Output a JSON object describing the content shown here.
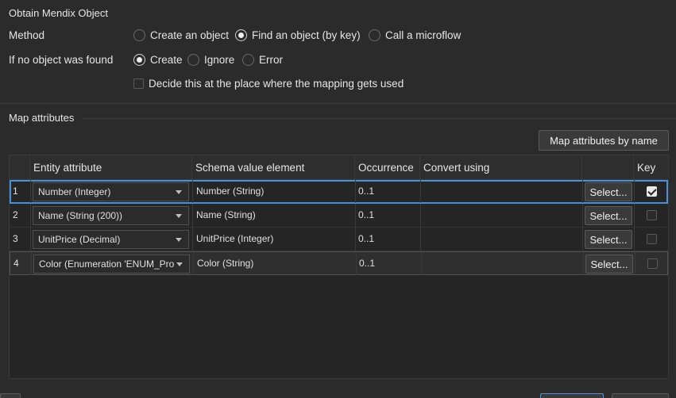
{
  "obtain": {
    "title": "Obtain Mendix Object",
    "method_label": "Method",
    "method_options": [
      "Create an object",
      "Find an object (by key)",
      "Call a microflow"
    ],
    "method_selected": 1,
    "not_found_label": "If no object was found",
    "not_found_options": [
      "Create",
      "Ignore",
      "Error"
    ],
    "not_found_selected": 0,
    "decide_label": "Decide this at the place where the mapping gets used"
  },
  "map": {
    "title": "Map attributes",
    "map_by_name_button": "Map attributes by name",
    "columns": {
      "entity_attribute": "Entity attribute",
      "schema_value_element": "Schema value element",
      "occurrence": "Occurrence",
      "convert_using": "Convert using",
      "key": "Key"
    },
    "rows": [
      {
        "index": "1",
        "entity": "Number (Integer)",
        "schema": "Number (String)",
        "occurrence": "0..1",
        "select": "Select...",
        "key": true
      },
      {
        "index": "2",
        "entity": "Name (String (200))",
        "schema": "Name (String)",
        "occurrence": "0..1",
        "select": "Select...",
        "key": false
      },
      {
        "index": "3",
        "entity": "UnitPrice (Decimal)",
        "schema": "UnitPrice (Integer)",
        "occurrence": "0..1",
        "select": "Select...",
        "key": false
      },
      {
        "index": "4",
        "entity": "Color (Enumeration 'ENUM_Pro",
        "schema": "Color (String)",
        "occurrence": "0..1",
        "select": "Select...",
        "key": false
      }
    ]
  },
  "colors": {
    "background": "#2b2b2b",
    "selection_outline": "#4a8fd8"
  }
}
